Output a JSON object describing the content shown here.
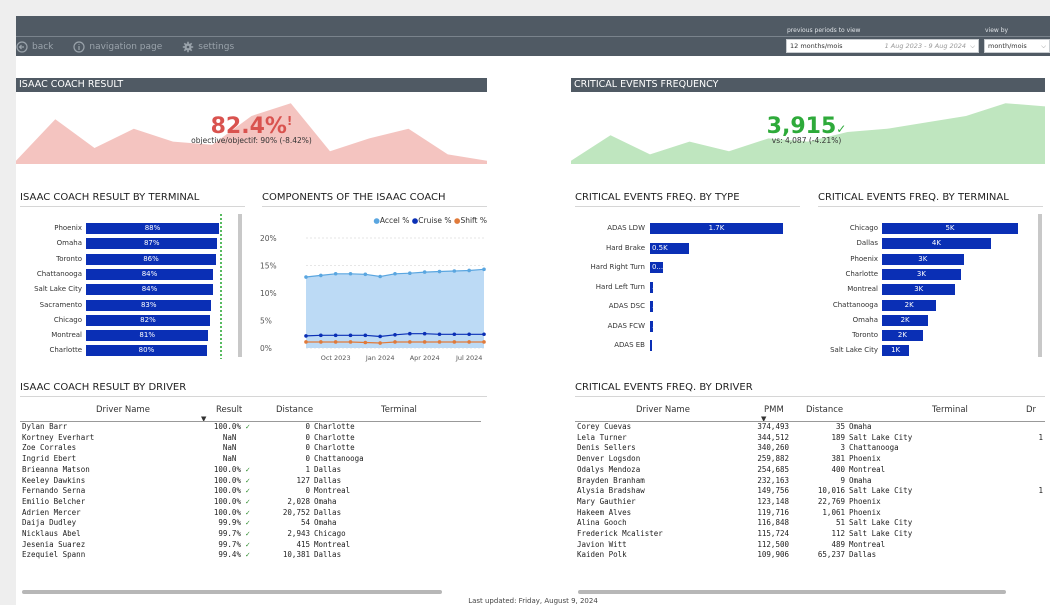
{
  "toolbar": {
    "back_label": "back",
    "navigation_label": "navigation page",
    "settings_label": "settings",
    "periods_label": "previous periods to view",
    "periods_value": "12 months/mois",
    "date_range": "1 Aug 2023 - 9 Aug 2024",
    "viewby_label": "view by",
    "viewby_value": "month/mois"
  },
  "colors": {
    "header": "#505a64",
    "bar": "#0a2fb5",
    "negative": "#d9534f",
    "positive": "#2eaa3a"
  },
  "isaac_result": {
    "title": "ISAAC COACH RESULT",
    "value": "82.4%",
    "alert_mark": "!",
    "subtitle": "objective/objectif: 90% (-8.42%)",
    "trend": [
      0.05,
      0.7,
      0.25,
      0.55,
      0.35,
      0.3,
      0.75,
      0.95,
      0.2,
      0.4,
      0.55,
      0.15,
      0.05
    ]
  },
  "critical_freq": {
    "title": "CRITICAL EVENTS FREQUENCY",
    "value": "3,915",
    "check_mark": "✓",
    "subtitle": "vs: 4,087 (-4.21%)",
    "trend": [
      0.05,
      0.45,
      0.15,
      0.35,
      0.2,
      0.4,
      0.35,
      0.5,
      0.55,
      0.65,
      0.75,
      0.95,
      0.9
    ]
  },
  "by_terminal": {
    "title": "ISAAC COACH RESULT BY TERMINAL",
    "rows": [
      {
        "label": "Phoenix",
        "value": 88,
        "text": "88%"
      },
      {
        "label": "Omaha",
        "value": 87,
        "text": "87%"
      },
      {
        "label": "Toronto",
        "value": 86,
        "text": "86%"
      },
      {
        "label": "Chattanooga",
        "value": 84,
        "text": "84%"
      },
      {
        "label": "Salt Lake City",
        "value": 84,
        "text": "84%"
      },
      {
        "label": "Sacramento",
        "value": 83,
        "text": "83%"
      },
      {
        "label": "Chicago",
        "value": 82,
        "text": "82%"
      },
      {
        "label": "Montreal",
        "value": 81,
        "text": "81%"
      },
      {
        "label": "Charlotte",
        "value": 80,
        "text": "80%"
      }
    ]
  },
  "components": {
    "title": "COMPONENTS OF THE ISAAC COACH",
    "legend": [
      "Accel %",
      "Cruise %",
      "Shift %"
    ],
    "yticks": [
      "20%",
      "15%",
      "10%",
      "5%",
      "0%"
    ],
    "xticks": [
      "Oct 2023",
      "Jan 2024",
      "Apr 2024",
      "Jul 2024"
    ]
  },
  "chart_data": {
    "type": "area",
    "x": [
      "Aug 2023",
      "Sep 2023",
      "Oct 2023",
      "Nov 2023",
      "Dec 2023",
      "Jan 2024",
      "Feb 2024",
      "Mar 2024",
      "Apr 2024",
      "May 2024",
      "Jun 2024",
      "Jul 2024",
      "Aug 2024"
    ],
    "series": [
      {
        "name": "Accel %",
        "values": [
          12.9,
          13.2,
          13.5,
          13.5,
          13.4,
          13.0,
          13.5,
          13.6,
          13.8,
          13.9,
          14.0,
          14.1,
          14.3
        ]
      },
      {
        "name": "Cruise %",
        "values": [
          2.2,
          2.3,
          2.3,
          2.3,
          2.3,
          2.1,
          2.4,
          2.6,
          2.6,
          2.5,
          2.5,
          2.5,
          2.5
        ]
      },
      {
        "name": "Shift %",
        "values": [
          1.1,
          1.1,
          1.1,
          1.1,
          1.0,
          0.9,
          1.1,
          1.1,
          1.1,
          1.1,
          1.1,
          1.1,
          1.1
        ]
      }
    ],
    "ylim": [
      0,
      20
    ],
    "colors": [
      "#5aa6e0",
      "#0a2fb5",
      "#e07a3a"
    ]
  },
  "by_type": {
    "title": "CRITICAL EVENTS FREQ. BY TYPE",
    "rows": [
      {
        "label": "ADAS LDW",
        "value": 1700,
        "text": "1.7K"
      },
      {
        "label": "Hard Brake",
        "value": 500,
        "text": "0.5K"
      },
      {
        "label": "Hard Right Turn",
        "value": 160,
        "text": "0..."
      },
      {
        "label": "Hard Left Turn",
        "value": 40,
        "text": "..."
      },
      {
        "label": "ADAS DSC",
        "value": 40,
        "text": "..."
      },
      {
        "label": "ADAS FCW",
        "value": 40,
        "text": "..."
      },
      {
        "label": "ADAS EB",
        "value": 5,
        "text": ""
      }
    ]
  },
  "freq_terminal": {
    "title": "CRITICAL EVENTS FREQ. BY TERMINAL",
    "rows": [
      {
        "label": "Chicago",
        "value": 5000,
        "text": "5K"
      },
      {
        "label": "Dallas",
        "value": 4000,
        "text": "4K"
      },
      {
        "label": "Phoenix",
        "value": 3000,
        "text": "3K"
      },
      {
        "label": "Charlotte",
        "value": 2900,
        "text": "3K"
      },
      {
        "label": "Montreal",
        "value": 2700,
        "text": "3K"
      },
      {
        "label": "Chattanooga",
        "value": 2000,
        "text": "2K"
      },
      {
        "label": "Omaha",
        "value": 1700,
        "text": "2K"
      },
      {
        "label": "Toronto",
        "value": 1500,
        "text": "2K"
      },
      {
        "label": "Salt Lake City",
        "value": 1000,
        "text": "1K"
      }
    ]
  },
  "by_driver": {
    "title": "ISAAC COACH RESULT BY DRIVER",
    "columns": [
      "Driver Name",
      "Result",
      "Distance",
      "Terminal"
    ],
    "rows": [
      {
        "name": "Dylan Barr",
        "result": "100.0%",
        "ok": true,
        "distance": "0",
        "terminal": "Charlotte"
      },
      {
        "name": "Kortney Everhart",
        "result": "NaN",
        "ok": false,
        "distance": "0",
        "terminal": "Charlotte"
      },
      {
        "name": "Zoe Corrales",
        "result": "NaN",
        "ok": false,
        "distance": "0",
        "terminal": "Charlotte"
      },
      {
        "name": "Ingrid Ebert",
        "result": "NaN",
        "ok": false,
        "distance": "0",
        "terminal": "Chattanooga"
      },
      {
        "name": "Brieanna Matson",
        "result": "100.0%",
        "ok": true,
        "distance": "1",
        "terminal": "Dallas"
      },
      {
        "name": "Keeley Dawkins",
        "result": "100.0%",
        "ok": true,
        "distance": "127",
        "terminal": "Dallas"
      },
      {
        "name": "Fernando Serna",
        "result": "100.0%",
        "ok": true,
        "distance": "0",
        "terminal": "Montreal"
      },
      {
        "name": "Emilio Belcher",
        "result": "100.0%",
        "ok": true,
        "distance": "2,028",
        "terminal": "Omaha"
      },
      {
        "name": "Adrien Mercer",
        "result": "100.0%",
        "ok": true,
        "distance": "20,752",
        "terminal": "Dallas"
      },
      {
        "name": "Daija Dudley",
        "result": "99.9%",
        "ok": true,
        "distance": "54",
        "terminal": "Omaha"
      },
      {
        "name": "Nicklaus Abel",
        "result": "99.7%",
        "ok": true,
        "distance": "2,943",
        "terminal": "Chicago"
      },
      {
        "name": "Jesenia Suarez",
        "result": "99.7%",
        "ok": true,
        "distance": "415",
        "terminal": "Montreal"
      },
      {
        "name": "Ezequiel Spann",
        "result": "99.4%",
        "ok": true,
        "distance": "10,381",
        "terminal": "Dallas"
      }
    ]
  },
  "freq_driver": {
    "title": "CRITICAL EVENTS FREQ. BY DRIVER",
    "columns": [
      "Driver Name",
      "PMM",
      "Distance",
      "Terminal",
      "Dr"
    ],
    "rows": [
      {
        "name": "Corey Cuevas",
        "pmm": "374,493",
        "distance": "35",
        "terminal": "Omaha",
        "dr": ""
      },
      {
        "name": "Lela Turner",
        "pmm": "344,512",
        "distance": "189",
        "terminal": "Salt Lake City",
        "dr": "1"
      },
      {
        "name": "Denis Sellers",
        "pmm": "340,260",
        "distance": "3",
        "terminal": "Chattanooga",
        "dr": ""
      },
      {
        "name": "Denver Logsdon",
        "pmm": "259,882",
        "distance": "381",
        "terminal": "Phoenix",
        "dr": ""
      },
      {
        "name": "Odalys Mendoza",
        "pmm": "254,685",
        "distance": "400",
        "terminal": "Montreal",
        "dr": ""
      },
      {
        "name": "Brayden Branham",
        "pmm": "232,163",
        "distance": "9",
        "terminal": "Omaha",
        "dr": ""
      },
      {
        "name": "Alysia Bradshaw",
        "pmm": "149,756",
        "distance": "10,016",
        "terminal": "Salt Lake City",
        "dr": "1"
      },
      {
        "name": "Mary Gauthier",
        "pmm": "123,148",
        "distance": "22,769",
        "terminal": "Phoenix",
        "dr": ""
      },
      {
        "name": "Hakeem Alves",
        "pmm": "119,716",
        "distance": "1,061",
        "terminal": "Phoenix",
        "dr": ""
      },
      {
        "name": "Alina Gooch",
        "pmm": "116,848",
        "distance": "51",
        "terminal": "Salt Lake City",
        "dr": ""
      },
      {
        "name": "Frederick Mcalister",
        "pmm": "115,724",
        "distance": "112",
        "terminal": "Salt Lake City",
        "dr": ""
      },
      {
        "name": "Javion Witt",
        "pmm": "112,500",
        "distance": "489",
        "terminal": "Montreal",
        "dr": ""
      },
      {
        "name": "Kaiden Polk",
        "pmm": "109,906",
        "distance": "65,237",
        "terminal": "Dallas",
        "dr": ""
      }
    ]
  },
  "footer": "Last updated: Friday, August 9, 2024"
}
